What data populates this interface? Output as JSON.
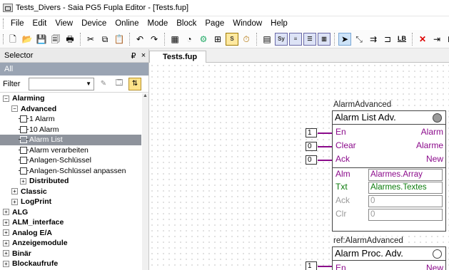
{
  "window": {
    "title": "Tests_Divers - Saia PG5 Fupla Editor - [Tests.fup]"
  },
  "menu": [
    "File",
    "Edit",
    "View",
    "Device",
    "Online",
    "Mode",
    "Block",
    "Page",
    "Window",
    "Help"
  ],
  "toolbar": {
    "icons": [
      "new-icon",
      "open-icon",
      "save-icon",
      "save-all-icon",
      "print-icon",
      "cut-icon",
      "copy-icon",
      "paste-icon",
      "undo-icon",
      "redo-icon",
      "calendar-icon",
      "online-icon",
      "build-icon",
      "fupla-icon",
      "sym-icon",
      "clock-icon",
      "page-icon",
      "sym-list-icon",
      "fbox-icon",
      "grid-icon",
      "grid2-icon",
      "pointer-icon",
      "line-icon",
      "connector-icon",
      "gate-icon",
      "lb-icon",
      "delete-icon",
      "insert-icon",
      "fbox-insert-icon"
    ],
    "labels": {
      "sym1": "Sym\n123",
      "sym2": "Sym",
      "lb": "LB"
    }
  },
  "selector": {
    "title": "Selector",
    "pin_glyph": "₽",
    "close_glyph": "×",
    "all_label": "All",
    "filter_label": "Filter",
    "tree": [
      {
        "label": "Alarming",
        "level": 0,
        "expander": "−",
        "bold": true
      },
      {
        "label": "Advanced",
        "level": 1,
        "expander": "−",
        "bold": true
      },
      {
        "label": "1 Alarm",
        "level": 2,
        "leaf": true
      },
      {
        "label": "10 Alarm",
        "level": 2,
        "leaf": true
      },
      {
        "label": "Alarm List",
        "level": 2,
        "leaf": true,
        "selected": true
      },
      {
        "label": "Alarm verarbeiten",
        "level": 2,
        "leaf": true
      },
      {
        "label": "Anlagen-Schlüssel",
        "level": 2,
        "leaf": true
      },
      {
        "label": "Anlagen-Schlüssel anpassen",
        "level": 2,
        "leaf": true
      },
      {
        "label": "Distributed",
        "level": 2,
        "expander": "+",
        "bold": true
      },
      {
        "label": "Classic",
        "level": 1,
        "expander": "+",
        "bold": true
      },
      {
        "label": "LogPrint",
        "level": 1,
        "expander": "+",
        "bold": true
      },
      {
        "label": "ALG",
        "level": 0,
        "expander": "+",
        "bold": true
      },
      {
        "label": "ALM_interface",
        "level": 0,
        "expander": "+",
        "bold": true
      },
      {
        "label": "Analog E/A",
        "level": 0,
        "expander": "+",
        "bold": true
      },
      {
        "label": "Anzeigemodule",
        "level": 0,
        "expander": "+",
        "bold": true
      },
      {
        "label": "Binär",
        "level": 0,
        "expander": "+",
        "bold": true
      },
      {
        "label": "Blockaufrufe",
        "level": 0,
        "expander": "+",
        "bold": true
      }
    ]
  },
  "document": {
    "tab": "Tests.fup",
    "block1": {
      "label": "AlarmAdvanced",
      "title": "Alarm List Adv.",
      "inputs": [
        {
          "name": "En",
          "value": "1"
        },
        {
          "name": "Clear",
          "value": "0"
        },
        {
          "name": "Ack",
          "value": "0"
        }
      ],
      "outputs": [
        "Alarm",
        "Alarme",
        "New"
      ],
      "params": [
        {
          "name": "Alm",
          "value": "Alarmes.Array",
          "color": "#8b0a8b"
        },
        {
          "name": "Txt",
          "value": "Alarmes.Textes",
          "color": "#0a7a0a"
        },
        {
          "name": "Ack",
          "value": "0",
          "color": "#9a9a9a"
        },
        {
          "name": "Clr",
          "value": "0",
          "color": "#9a9a9a"
        }
      ]
    },
    "block2": {
      "label": "ref:AlarmAdvanced",
      "title": "Alarm Proc. Adv.",
      "inputs": [
        {
          "name": "En",
          "value": "1"
        }
      ],
      "outputs": [
        "New"
      ]
    }
  }
}
